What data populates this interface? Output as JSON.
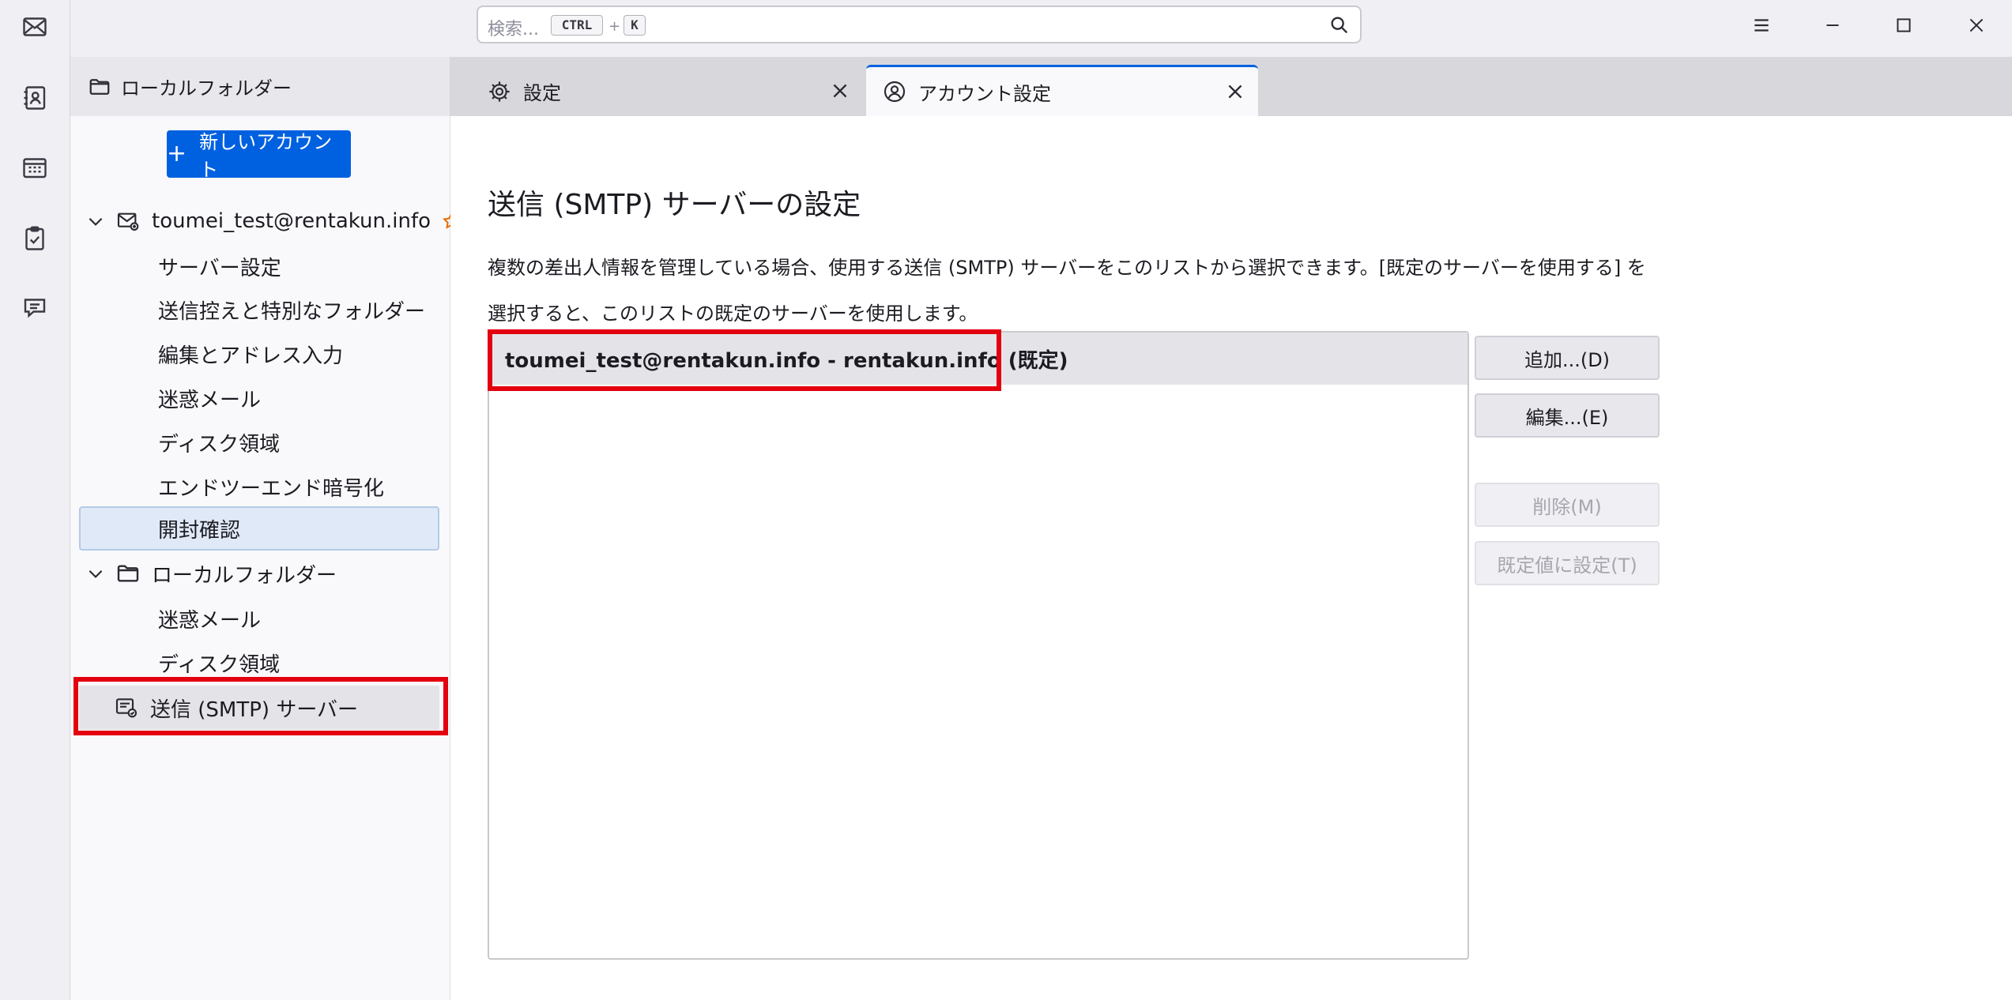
{
  "search": {
    "placeholder": "検索...",
    "shortcut_ctrl": "CTRL",
    "shortcut_plus": "+",
    "shortcut_key": "K"
  },
  "spaces": [
    "mail-icon",
    "address-book-icon",
    "calendar-icon",
    "tasks-icon",
    "chat-icon"
  ],
  "folder_header": {
    "label": "ローカルフォルダー"
  },
  "tabs": [
    {
      "label": "設定",
      "icon": "gear-icon"
    },
    {
      "label": "アカウント設定",
      "icon": "account-settings-icon",
      "active": true
    }
  ],
  "sidebar": {
    "new_account": "新しいアカウント",
    "account_email": "toumei_test@rentakun.info",
    "account_items": [
      "サーバー設定",
      "送信控えと特別なフォルダー",
      "編集とアドレス入力",
      "迷惑メール",
      "ディスク領域",
      "エンドツーエンド暗号化",
      "開封確認"
    ],
    "local_folders": "ローカルフォルダー",
    "local_items": [
      "迷惑メール",
      "ディスク領域"
    ],
    "smtp": "送信 (SMTP) サーバー"
  },
  "main": {
    "title": "送信 (SMTP) サーバーの設定",
    "description": "複数の差出人情報を管理している場合、使用する送信 (SMTP) サーバーをこのリストから選択できます。[既定のサーバーを使用する] を選択すると、このリストの既定のサーバーを使用します。",
    "server_entry": "toumei_test@rentakun.info - rentakun.info (既定)",
    "buttons": {
      "add": "追加...(D)",
      "edit": "編集...(E)",
      "remove": "削除(M)",
      "set_default": "既定値に設定(T)"
    }
  },
  "colors": {
    "accent": "#0061e0",
    "highlight": "#e3000f",
    "star": "#e66b00"
  }
}
